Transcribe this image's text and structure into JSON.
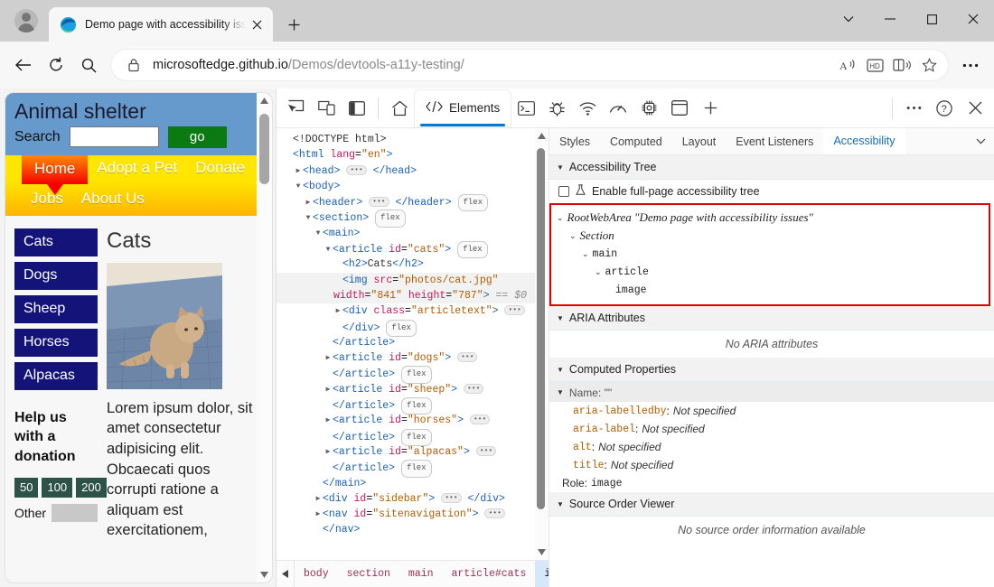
{
  "browser": {
    "tab": {
      "title": "Demo page with accessibility issu",
      "close_label": "✕",
      "favicon": "edge-logo-icon"
    },
    "new_tab_label": "+",
    "window_controls": {
      "more_tabs": "˅",
      "minimize": "—",
      "maximize": "□",
      "close": "✕"
    },
    "nav": {
      "back": "←",
      "reload": "↻",
      "search": "search-icon"
    },
    "omnibox": {
      "lock": "lock-icon",
      "url_host": "microsoftedge.github.io",
      "url_path": "/Demos/devtools-a11y-testing/",
      "actions": [
        "read-aloud-icon",
        "hd-icon",
        "immersive-reader-icon",
        "favorite-star-icon"
      ]
    },
    "settings_more": "···"
  },
  "webpage": {
    "site_title": "Animal shelter",
    "search_label": "Search",
    "search_value": "",
    "go_button": "go",
    "nav_items_row1": [
      "Home",
      "Adopt a Pet",
      "Donate"
    ],
    "nav_items_row2": [
      "Jobs",
      "About Us"
    ],
    "categories": [
      "Cats",
      "Dogs",
      "Sheep",
      "Horses",
      "Alpacas"
    ],
    "help_heading": "Help us with a donation",
    "donation_amounts": [
      "50",
      "100",
      "200"
    ],
    "other_label": "Other",
    "other_value": "",
    "article_heading": "Cats",
    "article_text": "Lorem ipsum dolor, sit amet consectetur adipisicing elit. Obcaecati quos corrupti ratione a aliquam est exercitationem,",
    "image_alt": "cat photo"
  },
  "devtools": {
    "toolbar_left_icons": [
      "inspect-element-icon",
      "device-emulation-icon",
      "dock-side-icon"
    ],
    "toolbar_tabs": [
      {
        "label": "",
        "icon": "home-icon",
        "active": false
      },
      {
        "label": "Elements",
        "icon": "elements-code-icon",
        "active": true
      }
    ],
    "toolbar_right_icons": [
      "console-icon",
      "sources-bug-icon",
      "network-icon",
      "performance-icon",
      "memory-icon",
      "application-icon",
      "more-tools-plus-icon"
    ],
    "toolbar_end_icons": [
      "more-options-icon",
      "help-icon",
      "close-devtools-icon"
    ],
    "dom_tree": [
      {
        "indent": 0,
        "twisty": "",
        "html": "<span class=\"txt\">&lt;!DOCTYPE html&gt;</span>"
      },
      {
        "indent": 0,
        "twisty": "",
        "html": "<span class=\"angle\">&lt;</span><span class=\"tag\">html</span> <span class=\"attn\">lang</span>=<span class=\"attv\">\"en\"</span><span class=\"angle\">&gt;</span>"
      },
      {
        "indent": 1,
        "twisty": "▶",
        "html": "<span class=\"angle\">&lt;</span><span class=\"tag\">head</span><span class=\"angle\">&gt;</span> <span class=\"dots\">•••</span> <span class=\"angle\">&lt;/</span><span class=\"tag\">head</span><span class=\"angle\">&gt;</span>"
      },
      {
        "indent": 1,
        "twisty": "▼",
        "html": "<span class=\"angle\">&lt;</span><span class=\"tag\">body</span><span class=\"angle\">&gt;</span>"
      },
      {
        "indent": 2,
        "twisty": "▶",
        "html": "<span class=\"angle\">&lt;</span><span class=\"tag\">header</span><span class=\"angle\">&gt;</span> <span class=\"dots\">•••</span> <span class=\"angle\">&lt;/</span><span class=\"tag\">header</span><span class=\"angle\">&gt;</span> <span class=\"flexbadge\">flex</span>"
      },
      {
        "indent": 2,
        "twisty": "▼",
        "html": "<span class=\"angle\">&lt;</span><span class=\"tag\">section</span><span class=\"angle\">&gt;</span> <span class=\"flexbadge\">flex</span>"
      },
      {
        "indent": 3,
        "twisty": "▼",
        "html": "<span class=\"angle\">&lt;</span><span class=\"tag\">main</span><span class=\"angle\">&gt;</span>"
      },
      {
        "indent": 4,
        "twisty": "▼",
        "html": "<span class=\"angle\">&lt;</span><span class=\"tag\">article</span> <span class=\"attn\">id</span>=<span class=\"attv\">\"cats\"</span><span class=\"angle\">&gt;</span> <span class=\"flexbadge\">flex</span>"
      },
      {
        "indent": 5,
        "twisty": "",
        "html": "<span class=\"angle\">&lt;</span><span class=\"tag\">h2</span><span class=\"angle\">&gt;</span><span class=\"txt\">Cats</span><span class=\"angle\">&lt;/</span><span class=\"tag\">h2</span><span class=\"angle\">&gt;</span>"
      },
      {
        "indent": 5,
        "twisty": "",
        "selected": true,
        "gutter": "•••",
        "wrap": true,
        "html": "<span class=\"angle\">&lt;</span><span class=\"tag\">img</span> <span class=\"attn\">src</span>=<span class=\"attv\">\"photos/cat.jpg\"</span> <span class=\"attn\">width</span>=<span class=\"attv\">\"841\"</span> <span class=\"attn\">height</span>=<span class=\"attv\">\"787\"</span><span class=\"angle\">&gt;</span> <span class=\"dollar\">== $0</span>"
      },
      {
        "indent": 5,
        "twisty": "▶",
        "html": "<span class=\"angle\">&lt;</span><span class=\"tag\">div</span> <span class=\"attn\">class</span>=<span class=\"attv\">\"articletext\"</span><span class=\"angle\">&gt;</span> <span class=\"dots\">•••</span>"
      },
      {
        "indent": 5,
        "twisty": "",
        "html": "<span class=\"angle\">&lt;/</span><span class=\"tag\">div</span><span class=\"angle\">&gt;</span> <span class=\"flexbadge\">flex</span>"
      },
      {
        "indent": 4,
        "twisty": "",
        "html": "<span class=\"angle\">&lt;/</span><span class=\"tag\">article</span><span class=\"angle\">&gt;</span>"
      },
      {
        "indent": 4,
        "twisty": "▶",
        "html": "<span class=\"angle\">&lt;</span><span class=\"tag\">article</span> <span class=\"attn\">id</span>=<span class=\"attv\">\"dogs\"</span><span class=\"angle\">&gt;</span> <span class=\"dots\">•••</span>"
      },
      {
        "indent": 4,
        "twisty": "",
        "html": "<span class=\"angle\">&lt;/</span><span class=\"tag\">article</span><span class=\"angle\">&gt;</span> <span class=\"flexbadge\">flex</span>"
      },
      {
        "indent": 4,
        "twisty": "▶",
        "html": "<span class=\"angle\">&lt;</span><span class=\"tag\">article</span> <span class=\"attn\">id</span>=<span class=\"attv\">\"sheep\"</span><span class=\"angle\">&gt;</span> <span class=\"dots\">•••</span>"
      },
      {
        "indent": 4,
        "twisty": "",
        "html": "<span class=\"angle\">&lt;/</span><span class=\"tag\">article</span><span class=\"angle\">&gt;</span> <span class=\"flexbadge\">flex</span>"
      },
      {
        "indent": 4,
        "twisty": "▶",
        "html": "<span class=\"angle\">&lt;</span><span class=\"tag\">article</span> <span class=\"attn\">id</span>=<span class=\"attv\">\"horses\"</span><span class=\"angle\">&gt;</span> <span class=\"dots\">•••</span>"
      },
      {
        "indent": 4,
        "twisty": "",
        "html": "<span class=\"angle\">&lt;/</span><span class=\"tag\">article</span><span class=\"angle\">&gt;</span> <span class=\"flexbadge\">flex</span>"
      },
      {
        "indent": 4,
        "twisty": "▶",
        "html": "<span class=\"angle\">&lt;</span><span class=\"tag\">article</span> <span class=\"attn\">id</span>=<span class=\"attv\">\"alpacas\"</span><span class=\"angle\">&gt;</span> <span class=\"dots\">•••</span>"
      },
      {
        "indent": 4,
        "twisty": "",
        "html": "<span class=\"angle\">&lt;/</span><span class=\"tag\">article</span><span class=\"angle\">&gt;</span> <span class=\"flexbadge\">flex</span>"
      },
      {
        "indent": 3,
        "twisty": "",
        "html": "<span class=\"angle\">&lt;/</span><span class=\"tag\">main</span><span class=\"angle\">&gt;</span>"
      },
      {
        "indent": 3,
        "twisty": "▶",
        "html": "<span class=\"angle\">&lt;</span><span class=\"tag\">div</span> <span class=\"attn\">id</span>=<span class=\"attv\">\"sidebar\"</span><span class=\"angle\">&gt;</span> <span class=\"dots\">•••</span> <span class=\"angle\">&lt;/</span><span class=\"tag\">div</span><span class=\"angle\">&gt;</span>"
      },
      {
        "indent": 3,
        "twisty": "▶",
        "html": "<span class=\"angle\">&lt;</span><span class=\"tag\">nav</span> <span class=\"attn\">id</span>=<span class=\"attv\">\"sitenavigation\"</span><span class=\"angle\">&gt;</span> <span class=\"dots\">•••</span>"
      },
      {
        "indent": 3,
        "twisty": "",
        "html": "<span class=\"angle\">&lt;/</span><span class=\"tag\">nav</span><span class=\"angle\">&gt;</span>"
      }
    ],
    "breadcrumb": {
      "left_arrow": "◀",
      "right_arrow": "▶",
      "items": [
        "body",
        "section",
        "main",
        "article#cats",
        "img"
      ],
      "active": "img"
    },
    "sidebar_tabs": [
      "Styles",
      "Computed",
      "Layout",
      "Event Listeners",
      "Accessibility"
    ],
    "sidebar_active_tab": "Accessibility",
    "sidebar_more": "˅",
    "accessibility": {
      "tree_section_title": "Accessibility Tree",
      "enable_fullpage_label": "Enable full-page accessibility tree",
      "enable_fullpage_checked": false,
      "tree_nodes": [
        {
          "indent": 0,
          "twisty": "⌄",
          "text": "RootWebArea \"Demo page with accessibility issues\"",
          "style": "ital"
        },
        {
          "indent": 1,
          "twisty": "⌄",
          "text": "Section",
          "style": "ital"
        },
        {
          "indent": 2,
          "twisty": "⌄",
          "text": "main",
          "style": "mono"
        },
        {
          "indent": 3,
          "twisty": "⌄",
          "text": "article",
          "style": "mono"
        },
        {
          "indent": 4,
          "twisty": "",
          "text": "image",
          "style": "mono"
        }
      ],
      "aria_section_title": "ARIA Attributes",
      "aria_empty": "No ARIA attributes",
      "computed_section_title": "Computed Properties",
      "name_header": "Name: \"\"",
      "name_props": [
        {
          "key": "aria-labelledby",
          "value": "Not specified"
        },
        {
          "key": "aria-label",
          "value": "Not specified"
        },
        {
          "key": "alt",
          "value": "Not specified"
        },
        {
          "key": "title",
          "value": "Not specified"
        }
      ],
      "role_key": "Role:",
      "role_value": "image",
      "source_order_title": "Source Order Viewer",
      "source_order_empty": "No source order information available"
    }
  },
  "colors": {
    "accent": "#0078d4",
    "a11y_highlight_border": "#e00000",
    "page_header_bg": "#6699cc",
    "page_nav_bg": "#ffe600",
    "category_btn_bg": "#13137a",
    "go_btn_bg": "#0b7a12",
    "donation_btn_bg": "#2d5248"
  }
}
